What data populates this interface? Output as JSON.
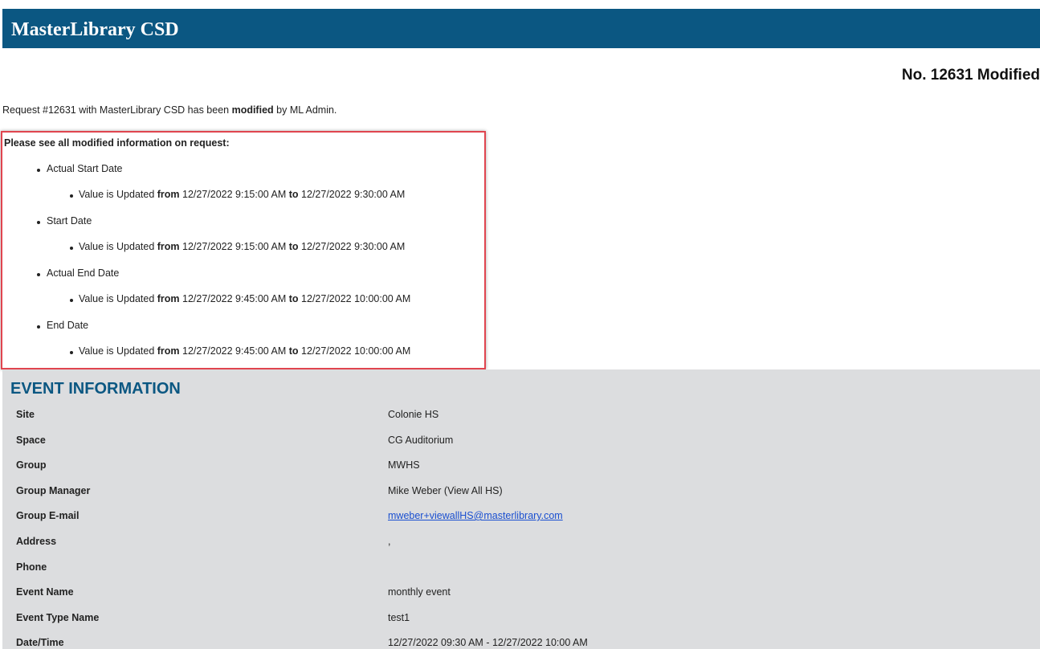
{
  "header": {
    "title": "MasterLibrary CSD"
  },
  "request_number": "No. 12631 Modified",
  "summary": {
    "prefix": "Request #12631 with MasterLibrary CSD has been ",
    "bold": "modified",
    "suffix": " by ML Admin."
  },
  "modifications": {
    "title": "Please see all modified information on request:",
    "value_updated": "Value is Updated ",
    "from_word": "from",
    "to_word": "to",
    "items": [
      {
        "field": "Actual Start Date",
        "from": " 12/27/2022 9:15:00 AM ",
        "to": " 12/27/2022 9:30:00 AM"
      },
      {
        "field": "Start Date",
        "from": " 12/27/2022 9:15:00 AM ",
        "to": " 12/27/2022 9:30:00 AM"
      },
      {
        "field": "Actual End Date",
        "from": " 12/27/2022 9:45:00 AM ",
        "to": " 12/27/2022 10:00:00 AM"
      },
      {
        "field": "End Date",
        "from": " 12/27/2022 9:45:00 AM ",
        "to": " 12/27/2022 10:00:00 AM"
      }
    ]
  },
  "event": {
    "title": "EVENT INFORMATION",
    "rows": [
      {
        "label": "Site",
        "value": "Colonie HS"
      },
      {
        "label": "Space",
        "value": "CG Auditorium"
      },
      {
        "label": "Group",
        "value": "MWHS"
      },
      {
        "label": "Group Manager",
        "value": "Mike Weber (View All HS)"
      },
      {
        "label": "Group E-mail",
        "value": "mweber+viewallHS@masterlibrary.com",
        "link": true
      },
      {
        "label": "Address",
        "value": ","
      },
      {
        "label": "Phone",
        "value": ""
      },
      {
        "label": "Event Name",
        "value": "monthly event"
      },
      {
        "label": "Event Type Name",
        "value": "test1"
      },
      {
        "label": "Date/Time",
        "value": "12/27/2022 09:30 AM - 12/27/2022 10:00 AM"
      }
    ]
  },
  "colors": {
    "header_bg": "#0b5782",
    "highlight_border": "#e0454f",
    "event_bg": "#dcdddf",
    "link": "#1a4fd0"
  }
}
